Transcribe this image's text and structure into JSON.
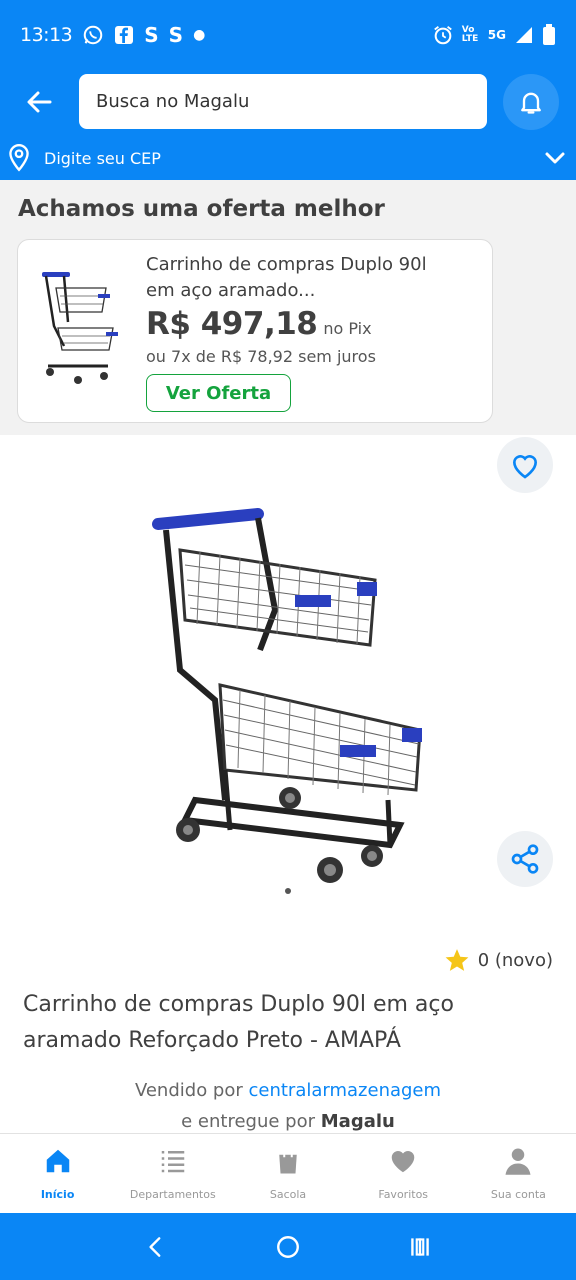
{
  "status": {
    "time": "13:13",
    "left_icons": [
      "whatsapp-icon",
      "facebook-icon",
      "s-icon",
      "s-icon",
      "dot-icon"
    ],
    "right_icons": [
      "alarm-icon",
      "volte-icon",
      "5g-icon",
      "signal-icon",
      "battery-icon"
    ],
    "network_label": "5G",
    "volte_label": "Vo LTE"
  },
  "header": {
    "search_placeholder": "Busca no Magalu",
    "cep_label": "Digite seu CEP"
  },
  "offer": {
    "section_title": "Achamos uma oferta melhor",
    "product_name": "Carrinho de compras Duplo 90l em aço aramado...",
    "price": "R$ 497,18",
    "price_suffix": "no Pix",
    "installments": "ou 7x de R$ 78,92 sem juros",
    "button_label": "Ver Oferta"
  },
  "product": {
    "rating_value": "0 (novo)",
    "title": "Carrinho de compras Duplo 90l em aço aramado Reforçado Preto - AMAPÁ",
    "sold_by_prefix": "Vendido por",
    "seller_name": "centralarmazenagem",
    "delivered_by_prefix": "e entregue por",
    "delivered_by": "Magalu"
  },
  "bottom_nav": [
    {
      "label": "Início",
      "icon": "home-icon",
      "active": true
    },
    {
      "label": "Departamentos",
      "icon": "list-icon",
      "active": false
    },
    {
      "label": "Sacola",
      "icon": "bag-icon",
      "active": false
    },
    {
      "label": "Favoritos",
      "icon": "heart-icon",
      "active": false
    },
    {
      "label": "Sua conta",
      "icon": "user-icon",
      "active": false
    }
  ],
  "colors": {
    "brand_blue": "#0a86f5",
    "green": "#14a33d",
    "star": "#f5c518"
  }
}
